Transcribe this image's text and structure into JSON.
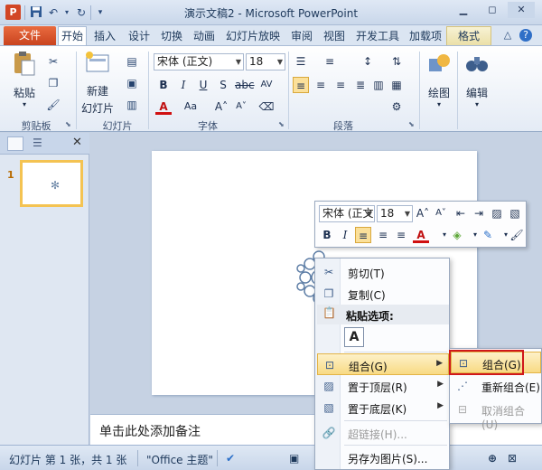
{
  "titlebar": {
    "app_icon": "P",
    "title": "演示文稿2 - Microsoft PowerPoint",
    "icons": [
      "save-icon",
      "undo-icon",
      "redo-icon",
      "customize-icon"
    ]
  },
  "tabs": {
    "file": "文件",
    "items": [
      "开始",
      "插入",
      "设计",
      "切换",
      "动画",
      "幻灯片放映",
      "审阅",
      "视图",
      "开发工具",
      "加载项"
    ],
    "active": "开始",
    "contextual": "格式"
  },
  "ribbon": {
    "clipboard": {
      "label": "剪贴板",
      "paste": "粘贴"
    },
    "slides": {
      "label": "幻灯片",
      "new_slide_line1": "新建",
      "new_slide_line2": "幻灯片"
    },
    "font": {
      "label": "字体",
      "font_name": "宋体 (正文)",
      "font_size": "18"
    },
    "paragraph": {
      "label": "段落"
    },
    "drawing": {
      "label": "绘图"
    },
    "editing": {
      "label": "编辑"
    }
  },
  "notes": {
    "placeholder": "单击此处添加备注"
  },
  "statusbar": {
    "slide_info": "幻灯片 第 1 张，共 1 张",
    "theme": "\"Office 主题\""
  },
  "thumbnails": {
    "number": "1"
  },
  "minitoolbar": {
    "font_name": "宋体 (正文",
    "font_size": "18"
  },
  "context_menu": {
    "items": {
      "cut": "剪切(T)",
      "copy": "复制(C)",
      "paste_options": "粘贴选项:",
      "group": "组合(G)",
      "bring_front": "置于顶层(R)",
      "send_back": "置于底层(K)",
      "hyperlink": "超链接(H)...",
      "save_picture": "另存为图片(S)..."
    }
  },
  "submenu": {
    "group": "组合(G)",
    "regroup": "重新组合(E)",
    "ungroup": "取消组合(U)"
  },
  "colors": {
    "accent": "#d24625",
    "highlight": "#f8da84",
    "redbox": "#d0181b"
  }
}
